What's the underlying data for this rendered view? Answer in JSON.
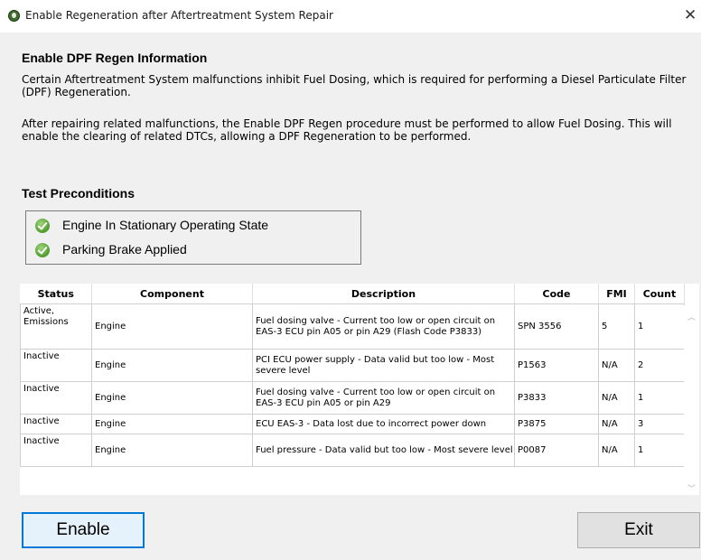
{
  "window": {
    "title": "Enable Regeneration after Aftertreatment System Repair",
    "close_glyph": "✕"
  },
  "info": {
    "heading": "Enable DPF Regen Information",
    "para1": "Certain Aftertreatment System malfunctions inhibit Fuel Dosing, which is required for performing a Diesel Particulate Filter (DPF) Regeneration.",
    "para2": "After repairing related malfunctions, the Enable DPF Regen procedure must be performed to allow Fuel Dosing. This will enable the clearing of related DTCs, allowing a DPF Regeneration to be performed."
  },
  "preconditions": {
    "heading": "Test Preconditions",
    "items": [
      {
        "label": "Engine In Stationary Operating State",
        "icon": "green-check-icon"
      },
      {
        "label": "Parking Brake Applied",
        "icon": "green-check-icon"
      }
    ]
  },
  "dtc_table": {
    "columns": [
      "Status",
      "Component",
      "Description",
      "Code",
      "FMI",
      "Count"
    ],
    "rows": [
      {
        "status": "Active, Emissions",
        "component": "Engine",
        "description": "Fuel dosing valve - Current too low or open circuit on EAS-3 ECU pin A05 or pin A29 (Flash Code P3833)",
        "code": "SPN 3556",
        "fmi": "5",
        "count": "1"
      },
      {
        "status": "Inactive",
        "component": "Engine",
        "description": "PCI ECU power supply - Data valid but too low - Most severe level",
        "code": "P1563",
        "fmi": "N/A",
        "count": "2"
      },
      {
        "status": "Inactive",
        "component": "Engine",
        "description": "Fuel dosing valve - Current too low or open circuit on EAS-3 ECU pin A05 or pin A29",
        "code": "P3833",
        "fmi": "N/A",
        "count": "1"
      },
      {
        "status": "Inactive",
        "component": "Engine",
        "description": "ECU EAS-3 - Data lost due to incorrect power down",
        "code": "P3875",
        "fmi": "N/A",
        "count": "3"
      },
      {
        "status": "Inactive",
        "component": "Engine",
        "description": "Fuel pressure - Data valid but too low - Most severe level",
        "code": "P0087",
        "fmi": "N/A",
        "count": "1"
      }
    ]
  },
  "buttons": {
    "enable": "Enable",
    "exit": "Exit"
  },
  "colors": {
    "focus_border": "#0078d7",
    "check_green": "#4f9a2b",
    "dialog_bg": "#f0f0f0"
  }
}
